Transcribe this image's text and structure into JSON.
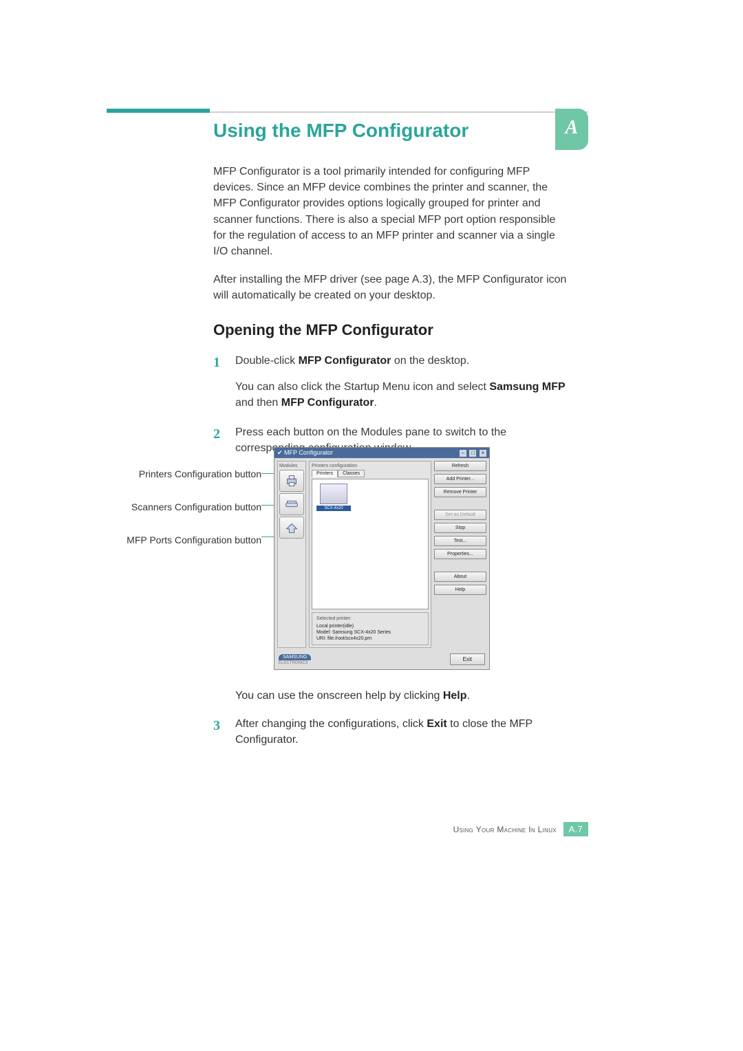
{
  "appendix_letter": "A",
  "section_title": "Using the MFP Configurator",
  "intro_p1": "MFP Configurator is a tool primarily intended for configuring MFP devices. Since an MFP device combines the printer and scanner, the MFP Configurator provides options logically grouped for printer and scanner functions. There is also a special MFP port option responsible for the regulation of access to an MFP printer and scanner via a single I/O channel.",
  "intro_p2": "After installing the MFP driver (see page A.3), the MFP Configurator icon will automatically be created on your desktop.",
  "subsection_title": "Opening the MFP Configurator",
  "step1": {
    "num": "1",
    "l1a": "Double-click ",
    "l1b": "MFP Configurator",
    "l1c": " on the desktop.",
    "l2a": "You can also click the Startup Menu icon and select ",
    "l2b": "Samsung MFP",
    "l2c": " and then ",
    "l2d": "MFP Configurator",
    "l2e": "."
  },
  "step2": {
    "num": "2",
    "text": "Press each button on the Modules pane to switch to the corresponding configuration window."
  },
  "callouts": {
    "printers": "Printers Configuration button",
    "scanners": "Scanners Configuration button",
    "ports": "MFP Ports Configuration button"
  },
  "shot": {
    "title": "MFP Configurator",
    "modules_label": "Modules",
    "center_legend": "Printers configuration",
    "tab_printers": "Printers",
    "tab_classes": "Classes",
    "printer_name": "SCX-4x20",
    "selected_legend": "Selected printer:",
    "sel_line1": "Local printer(idle)",
    "sel_line2": "Model: Samsung SCX-4x20 Series",
    "sel_line3": "URI: file:/root/scx4x20.pm",
    "buttons": {
      "refresh": "Refresh",
      "add": "Add Printer...",
      "remove": "Remove Printer",
      "setdefault": "Set as Default",
      "stop": "Stop",
      "test": "Test...",
      "properties": "Properties...",
      "about": "About",
      "help": "Help"
    },
    "brand": "SAMSUNG",
    "brand_sub": "ELECTRONICS",
    "exit": "Exit"
  },
  "post_shot_p_a": "You can use the onscreen help by clicking ",
  "post_shot_p_b": "Help",
  "post_shot_p_c": ".",
  "step3": {
    "num": "3",
    "a": "After changing the configurations, click ",
    "b": "Exit",
    "c": " to close the MFP Configurator."
  },
  "footer_text": "Using Your Machine In Linux",
  "footer_page": "A.7"
}
